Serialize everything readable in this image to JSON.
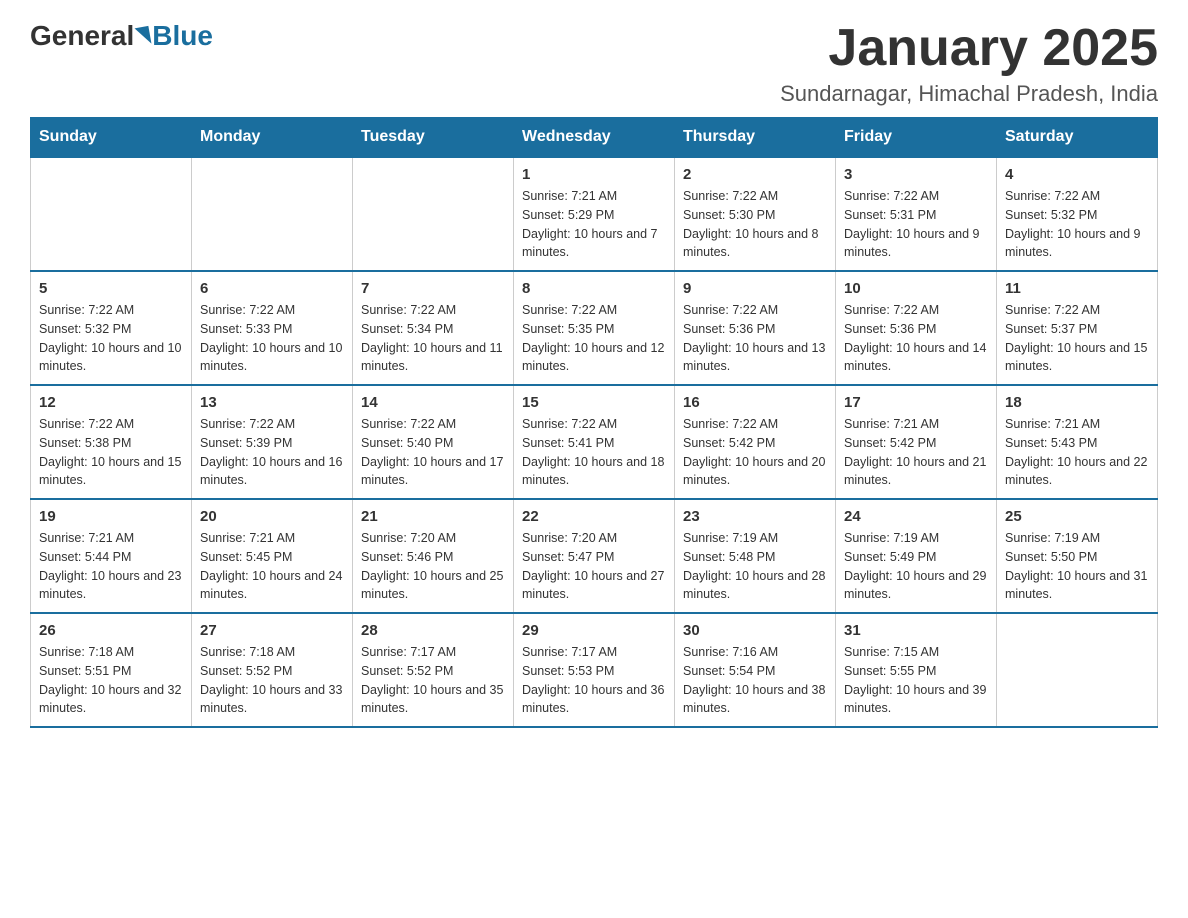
{
  "header": {
    "logo_general": "General",
    "logo_blue": "Blue",
    "month_title": "January 2025",
    "subtitle": "Sundarnagar, Himachal Pradesh, India"
  },
  "weekdays": [
    "Sunday",
    "Monday",
    "Tuesday",
    "Wednesday",
    "Thursday",
    "Friday",
    "Saturday"
  ],
  "weeks": [
    {
      "days": [
        {
          "num": "",
          "info": ""
        },
        {
          "num": "",
          "info": ""
        },
        {
          "num": "",
          "info": ""
        },
        {
          "num": "1",
          "info": "Sunrise: 7:21 AM\nSunset: 5:29 PM\nDaylight: 10 hours and 7 minutes."
        },
        {
          "num": "2",
          "info": "Sunrise: 7:22 AM\nSunset: 5:30 PM\nDaylight: 10 hours and 8 minutes."
        },
        {
          "num": "3",
          "info": "Sunrise: 7:22 AM\nSunset: 5:31 PM\nDaylight: 10 hours and 9 minutes."
        },
        {
          "num": "4",
          "info": "Sunrise: 7:22 AM\nSunset: 5:32 PM\nDaylight: 10 hours and 9 minutes."
        }
      ]
    },
    {
      "days": [
        {
          "num": "5",
          "info": "Sunrise: 7:22 AM\nSunset: 5:32 PM\nDaylight: 10 hours and 10 minutes."
        },
        {
          "num": "6",
          "info": "Sunrise: 7:22 AM\nSunset: 5:33 PM\nDaylight: 10 hours and 10 minutes."
        },
        {
          "num": "7",
          "info": "Sunrise: 7:22 AM\nSunset: 5:34 PM\nDaylight: 10 hours and 11 minutes."
        },
        {
          "num": "8",
          "info": "Sunrise: 7:22 AM\nSunset: 5:35 PM\nDaylight: 10 hours and 12 minutes."
        },
        {
          "num": "9",
          "info": "Sunrise: 7:22 AM\nSunset: 5:36 PM\nDaylight: 10 hours and 13 minutes."
        },
        {
          "num": "10",
          "info": "Sunrise: 7:22 AM\nSunset: 5:36 PM\nDaylight: 10 hours and 14 minutes."
        },
        {
          "num": "11",
          "info": "Sunrise: 7:22 AM\nSunset: 5:37 PM\nDaylight: 10 hours and 15 minutes."
        }
      ]
    },
    {
      "days": [
        {
          "num": "12",
          "info": "Sunrise: 7:22 AM\nSunset: 5:38 PM\nDaylight: 10 hours and 15 minutes."
        },
        {
          "num": "13",
          "info": "Sunrise: 7:22 AM\nSunset: 5:39 PM\nDaylight: 10 hours and 16 minutes."
        },
        {
          "num": "14",
          "info": "Sunrise: 7:22 AM\nSunset: 5:40 PM\nDaylight: 10 hours and 17 minutes."
        },
        {
          "num": "15",
          "info": "Sunrise: 7:22 AM\nSunset: 5:41 PM\nDaylight: 10 hours and 18 minutes."
        },
        {
          "num": "16",
          "info": "Sunrise: 7:22 AM\nSunset: 5:42 PM\nDaylight: 10 hours and 20 minutes."
        },
        {
          "num": "17",
          "info": "Sunrise: 7:21 AM\nSunset: 5:42 PM\nDaylight: 10 hours and 21 minutes."
        },
        {
          "num": "18",
          "info": "Sunrise: 7:21 AM\nSunset: 5:43 PM\nDaylight: 10 hours and 22 minutes."
        }
      ]
    },
    {
      "days": [
        {
          "num": "19",
          "info": "Sunrise: 7:21 AM\nSunset: 5:44 PM\nDaylight: 10 hours and 23 minutes."
        },
        {
          "num": "20",
          "info": "Sunrise: 7:21 AM\nSunset: 5:45 PM\nDaylight: 10 hours and 24 minutes."
        },
        {
          "num": "21",
          "info": "Sunrise: 7:20 AM\nSunset: 5:46 PM\nDaylight: 10 hours and 25 minutes."
        },
        {
          "num": "22",
          "info": "Sunrise: 7:20 AM\nSunset: 5:47 PM\nDaylight: 10 hours and 27 minutes."
        },
        {
          "num": "23",
          "info": "Sunrise: 7:19 AM\nSunset: 5:48 PM\nDaylight: 10 hours and 28 minutes."
        },
        {
          "num": "24",
          "info": "Sunrise: 7:19 AM\nSunset: 5:49 PM\nDaylight: 10 hours and 29 minutes."
        },
        {
          "num": "25",
          "info": "Sunrise: 7:19 AM\nSunset: 5:50 PM\nDaylight: 10 hours and 31 minutes."
        }
      ]
    },
    {
      "days": [
        {
          "num": "26",
          "info": "Sunrise: 7:18 AM\nSunset: 5:51 PM\nDaylight: 10 hours and 32 minutes."
        },
        {
          "num": "27",
          "info": "Sunrise: 7:18 AM\nSunset: 5:52 PM\nDaylight: 10 hours and 33 minutes."
        },
        {
          "num": "28",
          "info": "Sunrise: 7:17 AM\nSunset: 5:52 PM\nDaylight: 10 hours and 35 minutes."
        },
        {
          "num": "29",
          "info": "Sunrise: 7:17 AM\nSunset: 5:53 PM\nDaylight: 10 hours and 36 minutes."
        },
        {
          "num": "30",
          "info": "Sunrise: 7:16 AM\nSunset: 5:54 PM\nDaylight: 10 hours and 38 minutes."
        },
        {
          "num": "31",
          "info": "Sunrise: 7:15 AM\nSunset: 5:55 PM\nDaylight: 10 hours and 39 minutes."
        },
        {
          "num": "",
          "info": ""
        }
      ]
    }
  ]
}
